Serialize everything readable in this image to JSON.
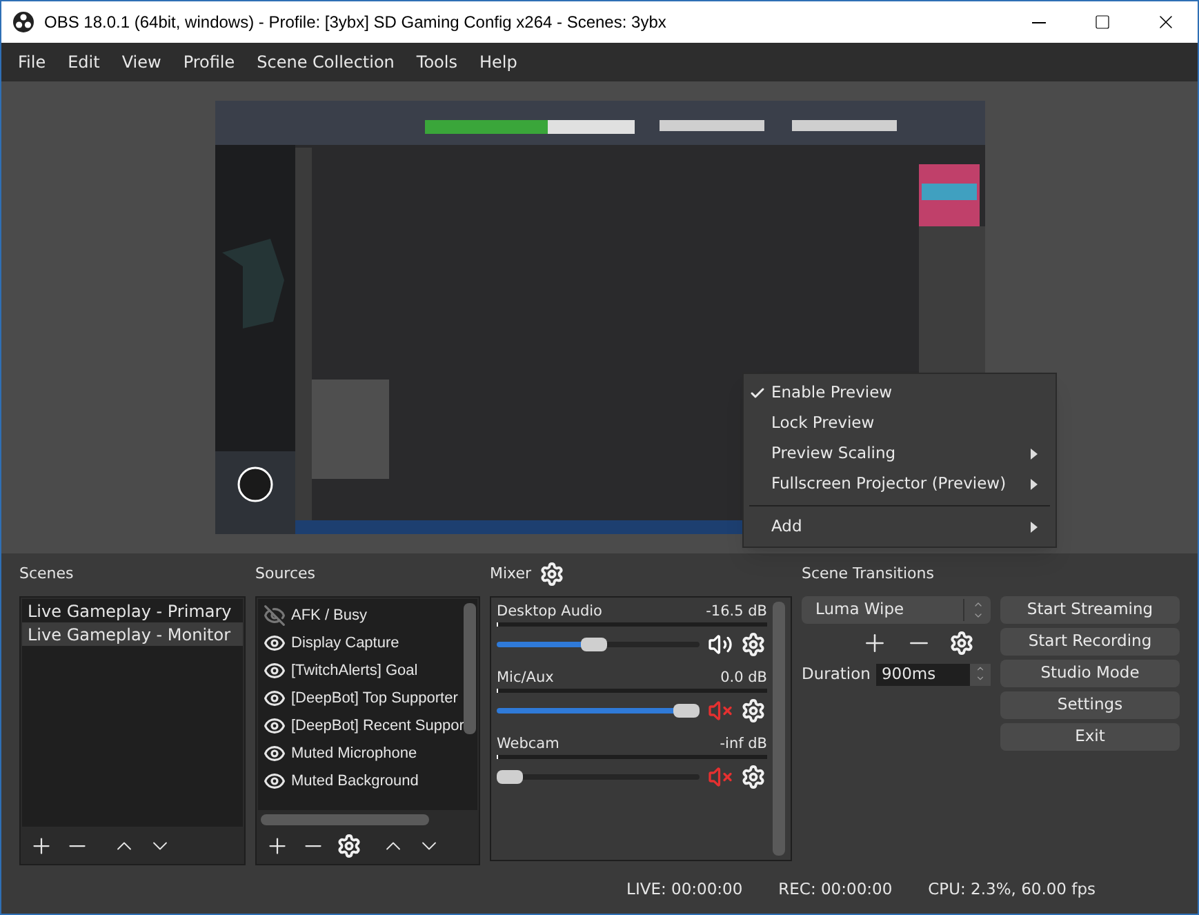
{
  "window": {
    "title": "OBS 18.0.1 (64bit, windows) - Profile: [3ybx] SD Gaming Config x264 - Scenes: 3ybx"
  },
  "menu": [
    "File",
    "Edit",
    "View",
    "Profile",
    "Scene Collection",
    "Tools",
    "Help"
  ],
  "preview": {
    "kind": "picture"
  },
  "context_menu": [
    {
      "kind": "item",
      "label": "Enable Preview",
      "checked": true,
      "submenu": false
    },
    {
      "kind": "item",
      "label": "Lock Preview",
      "checked": false,
      "submenu": false
    },
    {
      "kind": "item",
      "label": "Preview Scaling",
      "checked": false,
      "submenu": true
    },
    {
      "kind": "item",
      "label": "Fullscreen Projector (Preview)",
      "checked": false,
      "submenu": true
    },
    {
      "kind": "separator"
    },
    {
      "kind": "item",
      "label": "Add",
      "checked": false,
      "submenu": true
    }
  ],
  "scenes": {
    "title": "Scenes",
    "items": [
      {
        "label": "Live Gameplay - Primary",
        "selected": false
      },
      {
        "label": "Live Gameplay - Monitor",
        "selected": true
      }
    ]
  },
  "sources": {
    "title": "Sources",
    "items": [
      {
        "label": "AFK / Busy",
        "visible": false
      },
      {
        "label": "Display Capture",
        "visible": true
      },
      {
        "label": "[TwitchAlerts] Goal",
        "visible": true
      },
      {
        "label": "[DeepBot] Top Supporter",
        "visible": true
      },
      {
        "label": "[DeepBot] Recent Suppor",
        "visible": true
      },
      {
        "label": "Muted Microphone",
        "visible": true
      },
      {
        "label": "Muted Background",
        "visible": true
      }
    ]
  },
  "mixer": {
    "title": "Mixer",
    "channels": [
      {
        "name": "Desktop Audio",
        "reading": "-16.5 dB",
        "level": 0.48,
        "muted": false
      },
      {
        "name": "Mic/Aux",
        "reading": "0.0 dB",
        "level": 1,
        "muted": true
      },
      {
        "name": "Webcam",
        "reading": "-inf dB",
        "level": 0,
        "muted": true
      }
    ]
  },
  "scene_transitions": {
    "title": "Scene Transitions",
    "transition": "Luma Wipe",
    "duration_label": "Duration",
    "duration": "900ms"
  },
  "controls": [
    "Start Streaming",
    "Start Recording",
    "Studio Mode",
    "Settings",
    "Exit"
  ],
  "status_bar": {
    "live": "LIVE: 00:00:00",
    "rec": "REC: 00:00:00",
    "cpu": "CPU: 2.3%, 60.00 fps"
  }
}
